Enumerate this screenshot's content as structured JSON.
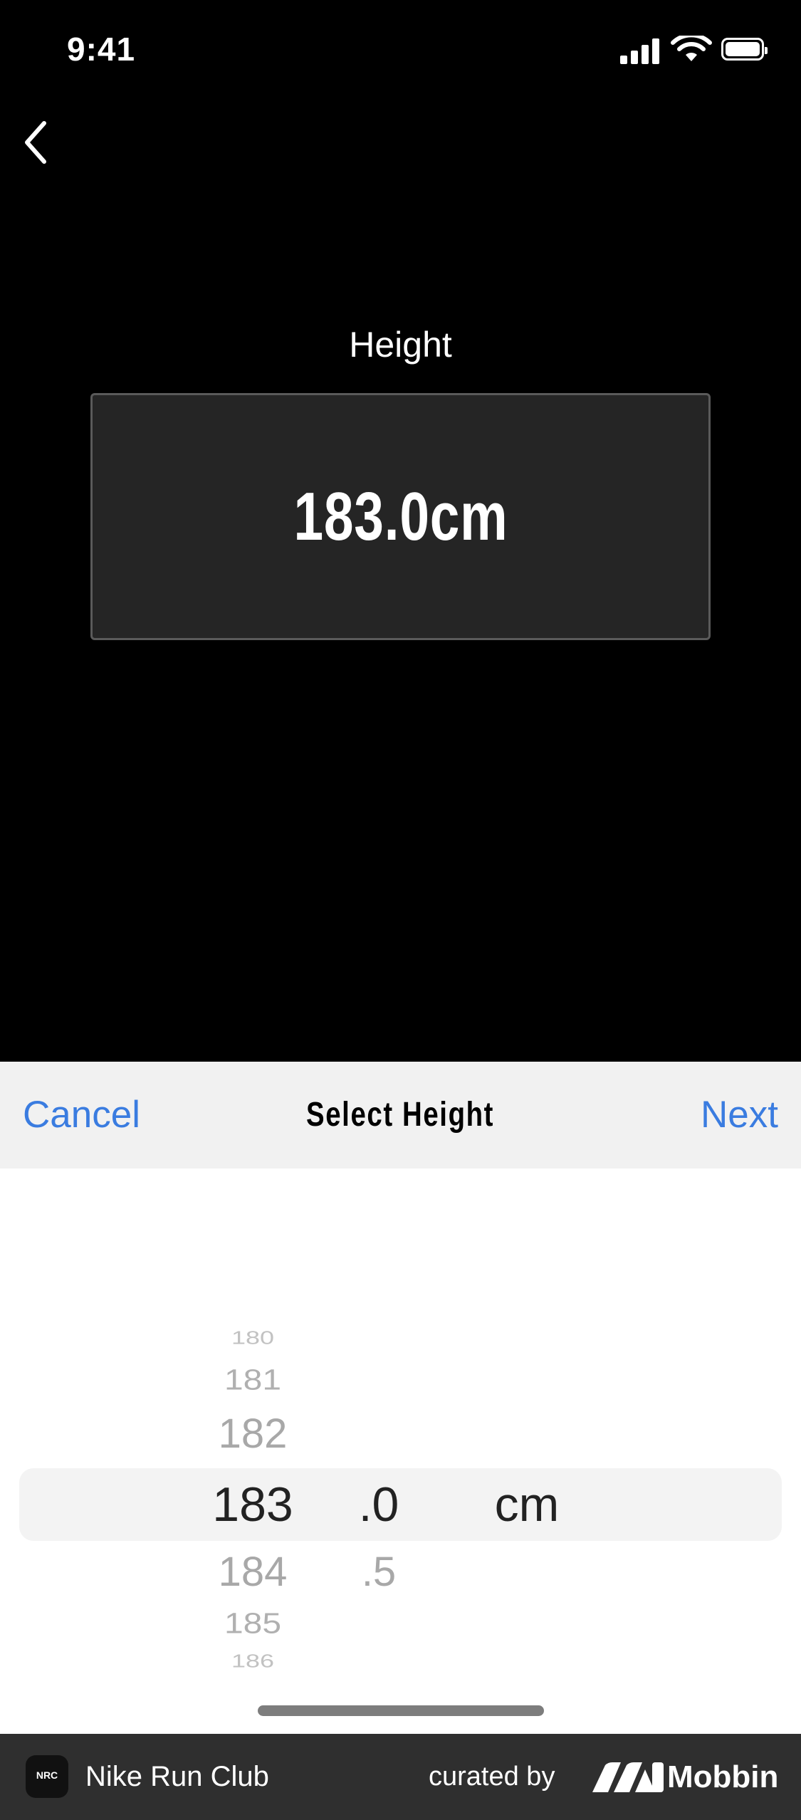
{
  "status_bar": {
    "time": "9:41"
  },
  "header": {
    "back_icon": "chevron-left-icon"
  },
  "main": {
    "title": "Height",
    "value": "183.0cm"
  },
  "picker": {
    "title": "Select Height",
    "cancel_label": "Cancel",
    "next_label": "Next",
    "integers": [
      "180",
      "181",
      "182",
      "183",
      "184",
      "185",
      "186"
    ],
    "selected_integer": "183",
    "decimals": [
      ".0",
      ".5"
    ],
    "selected_decimal": ".0",
    "unit": "cm"
  },
  "credit_bar": {
    "app_icon_text": "NRC",
    "app_name": "Nike Run Club",
    "curated_by": "curated by",
    "brand": "Mobbin"
  },
  "colors": {
    "accent": "#3a7ce0",
    "background": "#000000",
    "sheet": "#ffffff"
  }
}
